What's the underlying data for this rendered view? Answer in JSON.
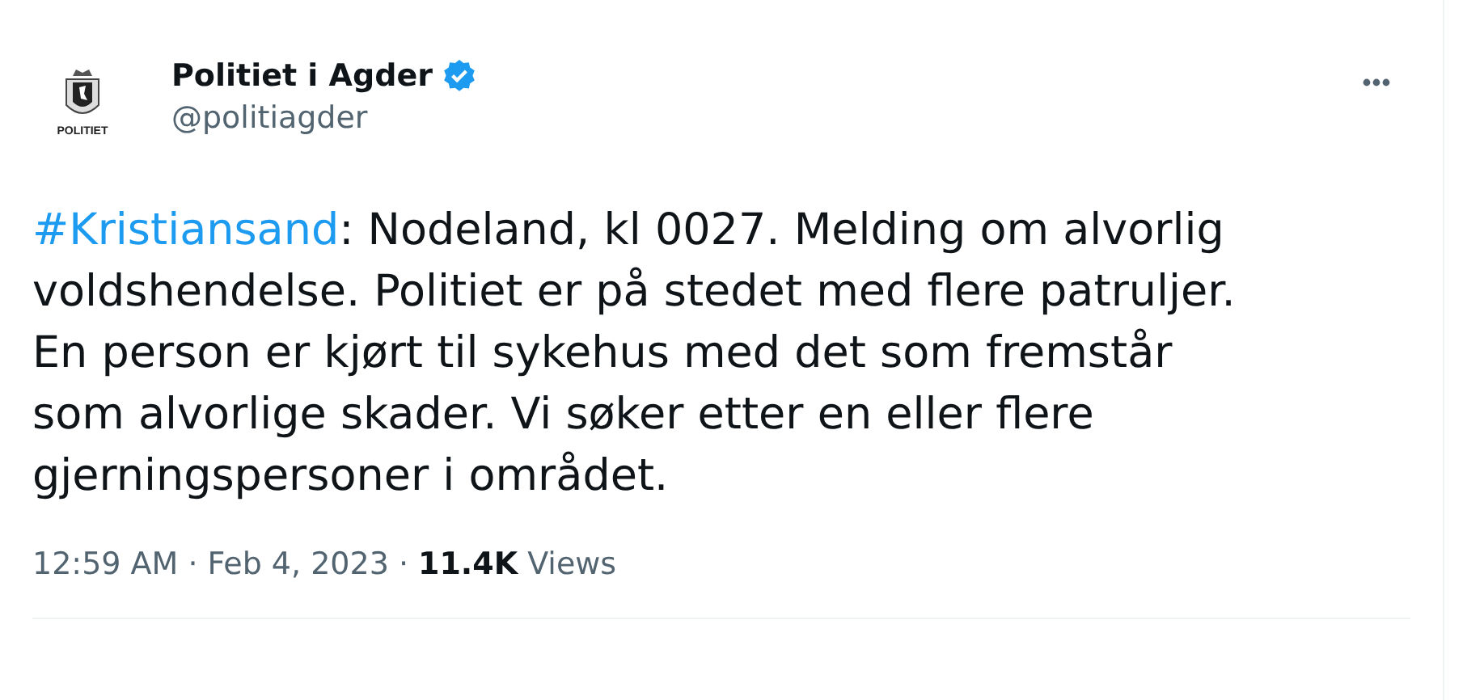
{
  "author": {
    "logo_text": "POLITIET",
    "name": "Politiet i Agder",
    "verified": true,
    "handle": "@politiagder"
  },
  "tweet": {
    "hashtag": "#Kristiansand",
    "text": ": Nodeland, kl 0027. Melding om alvorlig voldshendelse. Politiet er på stedet med flere patruljer. En person er kjørt til sykehus med det som fremstår som alvorlige skader. Vi søker etter en eller flere gjerningspersoner i området."
  },
  "meta": {
    "time": "12:59 AM",
    "separator_1": "·",
    "date": "Feb 4, 2023",
    "separator_2": "·",
    "views_count": "11.4K",
    "views_label": "Views"
  }
}
